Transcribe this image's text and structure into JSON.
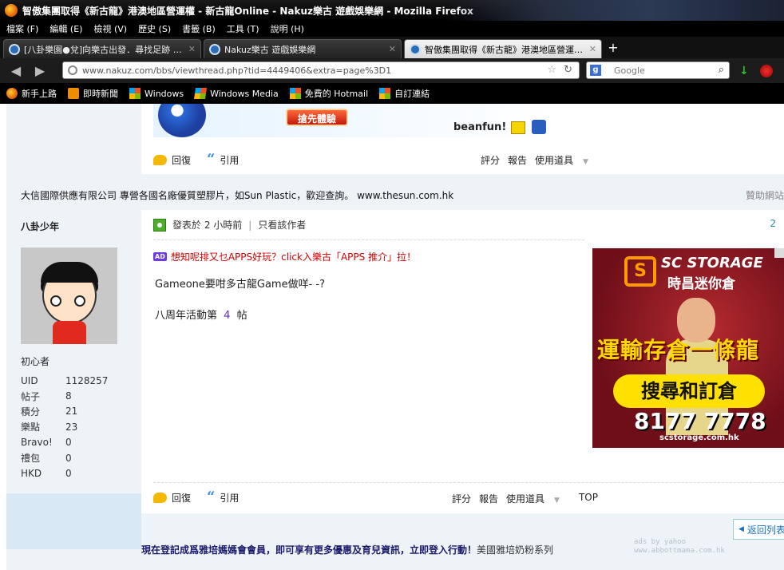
{
  "browser": {
    "window_title": "智傲集團取得《新古龍》港澳地區營運權 - 新古龍Online - Nakuz樂古 遊戲娛樂網 - Mozilla Firefox",
    "menu": [
      "檔案 (F)",
      "編輯 (E)",
      "檢視 (V)",
      "歷史 (S)",
      "書籤 (B)",
      "工具 (T)",
      "說明 (H)"
    ],
    "tabs": [
      {
        "label": "[八卦樂園●兌]向樂古出發．尋找足跡 II - ...",
        "active": false
      },
      {
        "label": "Nakuz樂古 遊戲娛樂網",
        "active": false
      },
      {
        "label": "智傲集團取得《新古龍》港澳地區營運權 ...",
        "active": true
      }
    ],
    "url": "www.nakuz.com/bbs/viewthread.php?tid=4449406&extra=page%3D1",
    "search_placeholder": "Google",
    "bookmarks": [
      {
        "label": "新手上路",
        "icon": "firefox-icon"
      },
      {
        "label": "即時新聞",
        "icon": "rss-icon"
      },
      {
        "label": "Windows",
        "icon": "windows-icon"
      },
      {
        "label": "Windows Media",
        "icon": "windows-media-icon"
      },
      {
        "label": "免費的 Hotmail",
        "icon": "windows-icon"
      },
      {
        "label": "自訂連結",
        "icon": "windows-icon"
      }
    ]
  },
  "banner_ad": {
    "button": "搶先體驗",
    "brand": "beanfun!"
  },
  "post_actions_top": {
    "reply": "回復",
    "quote": "引用",
    "rate": "評分",
    "report": "報告",
    "tools": "使用道具"
  },
  "sponsor": {
    "text": "大信國際供應有限公司 專營各國名廠優質塑膠片，如Sun Plastic，歡迎查詢。 www.thesun.com.hk",
    "label": "贊助網站"
  },
  "author": {
    "name": "八卦少年",
    "rank": "初心者",
    "stats": [
      {
        "k": "UID",
        "v": "1128257"
      },
      {
        "k": "帖子",
        "v": "8"
      },
      {
        "k": "積分",
        "v": "21"
      },
      {
        "k": "樂點",
        "v": "23"
      },
      {
        "k": "Bravo!",
        "v": "0"
      },
      {
        "k": "禮包",
        "v": "0"
      },
      {
        "k": "HKD",
        "v": "0"
      }
    ]
  },
  "post": {
    "posted": "發表於 2 小時前",
    "sep": "|",
    "only_author": "只看該作者",
    "floor": "2",
    "ad_badge": "AD",
    "ad_text": "想知呢排又乜APPS好玩？click入樂古「APPS 推介」拉！",
    "line1": "Gameone要咁多古龍Game做咩- -?",
    "line2_prefix": "八周年活動第",
    "line2_num": "4",
    "line2_suffix": "帖"
  },
  "side_ad": {
    "logo": "S",
    "brand": "SC STORAGE",
    "brand_cn": "時昌迷你倉",
    "slogan": "運輸存倉一條龍",
    "cta": "搜尋和訂倉",
    "phone": "8177 7778",
    "url": "scstorage.com.hk"
  },
  "post_actions_bottom": {
    "reply": "回復",
    "quote": "引用",
    "rate": "評分",
    "report": "報告",
    "tools": "使用道具",
    "top": "TOP"
  },
  "footer": {
    "return": "返回列表",
    "promo": "現在登記成爲雅培媽媽會會員，即可享有更多優惠及育兒資訊，立即登入行動！",
    "promo_tail": "美國雅培奶粉系列",
    "yahoo": "ads by yahoo",
    "yahoo_url": "www.abbottmama.com.hk"
  }
}
